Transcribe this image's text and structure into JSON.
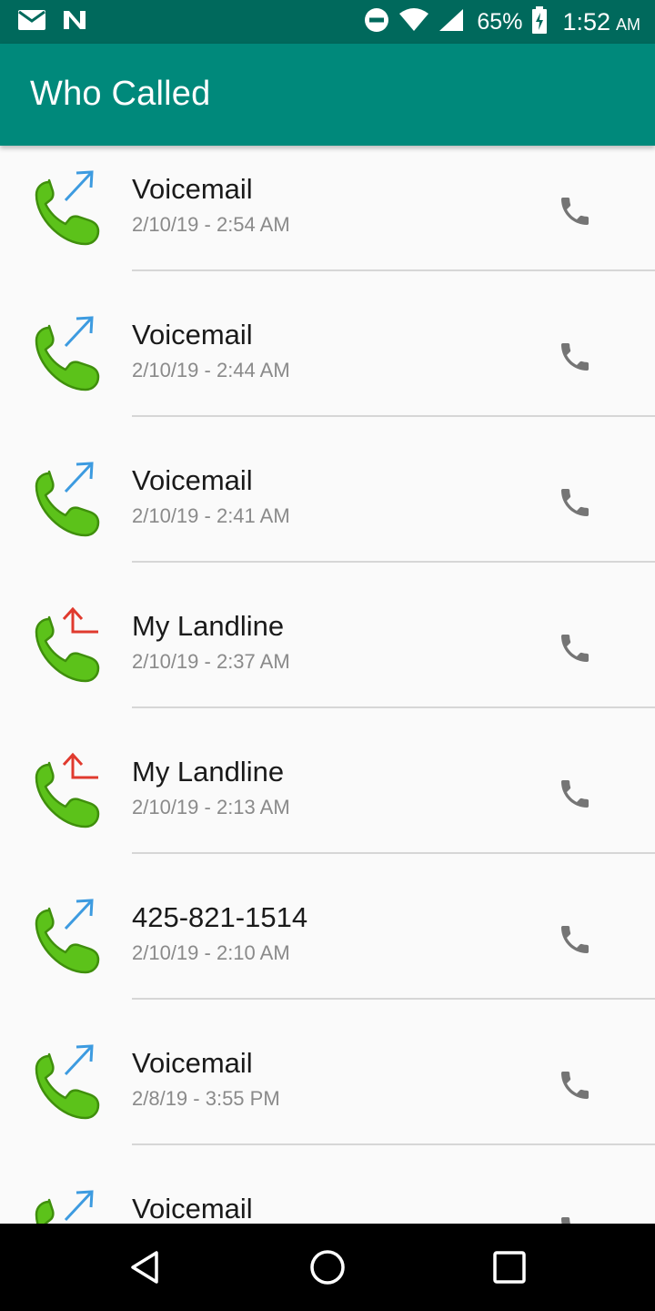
{
  "status_bar": {
    "battery_percent": "65%",
    "time": "1:52",
    "ampm": "AM",
    "icons": [
      "mail-icon",
      "n-app-icon",
      "do-not-disturb-icon",
      "wifi-icon",
      "cell-signal-icon",
      "battery-charging-icon"
    ]
  },
  "app_bar": {
    "title": "Who Called"
  },
  "calls": [
    {
      "name": "Voicemail",
      "time": "2/10/19 - 2:54 AM",
      "direction": "outgoing"
    },
    {
      "name": "Voicemail",
      "time": "2/10/19 - 2:44 AM",
      "direction": "outgoing"
    },
    {
      "name": "Voicemail",
      "time": "2/10/19 - 2:41 AM",
      "direction": "outgoing"
    },
    {
      "name": "My Landline",
      "time": "2/10/19 - 2:37 AM",
      "direction": "missed"
    },
    {
      "name": "My Landline",
      "time": "2/10/19 - 2:13 AM",
      "direction": "missed"
    },
    {
      "name": "425-821-1514",
      "time": "2/10/19 - 2:10 AM",
      "direction": "outgoing"
    },
    {
      "name": "Voicemail",
      "time": "2/8/19 - 3:55 PM",
      "direction": "outgoing"
    },
    {
      "name": "Voicemail",
      "time": "",
      "direction": "outgoing"
    }
  ],
  "colors": {
    "status_bar": "#00695c",
    "app_bar": "#00897b",
    "handset_green": "#5cc21a",
    "outgoing_arrow": "#3d9be0",
    "missed_arrow": "#e03a2e"
  },
  "nav_bar": {
    "icons": [
      "back-icon",
      "home-icon",
      "recents-icon"
    ]
  }
}
